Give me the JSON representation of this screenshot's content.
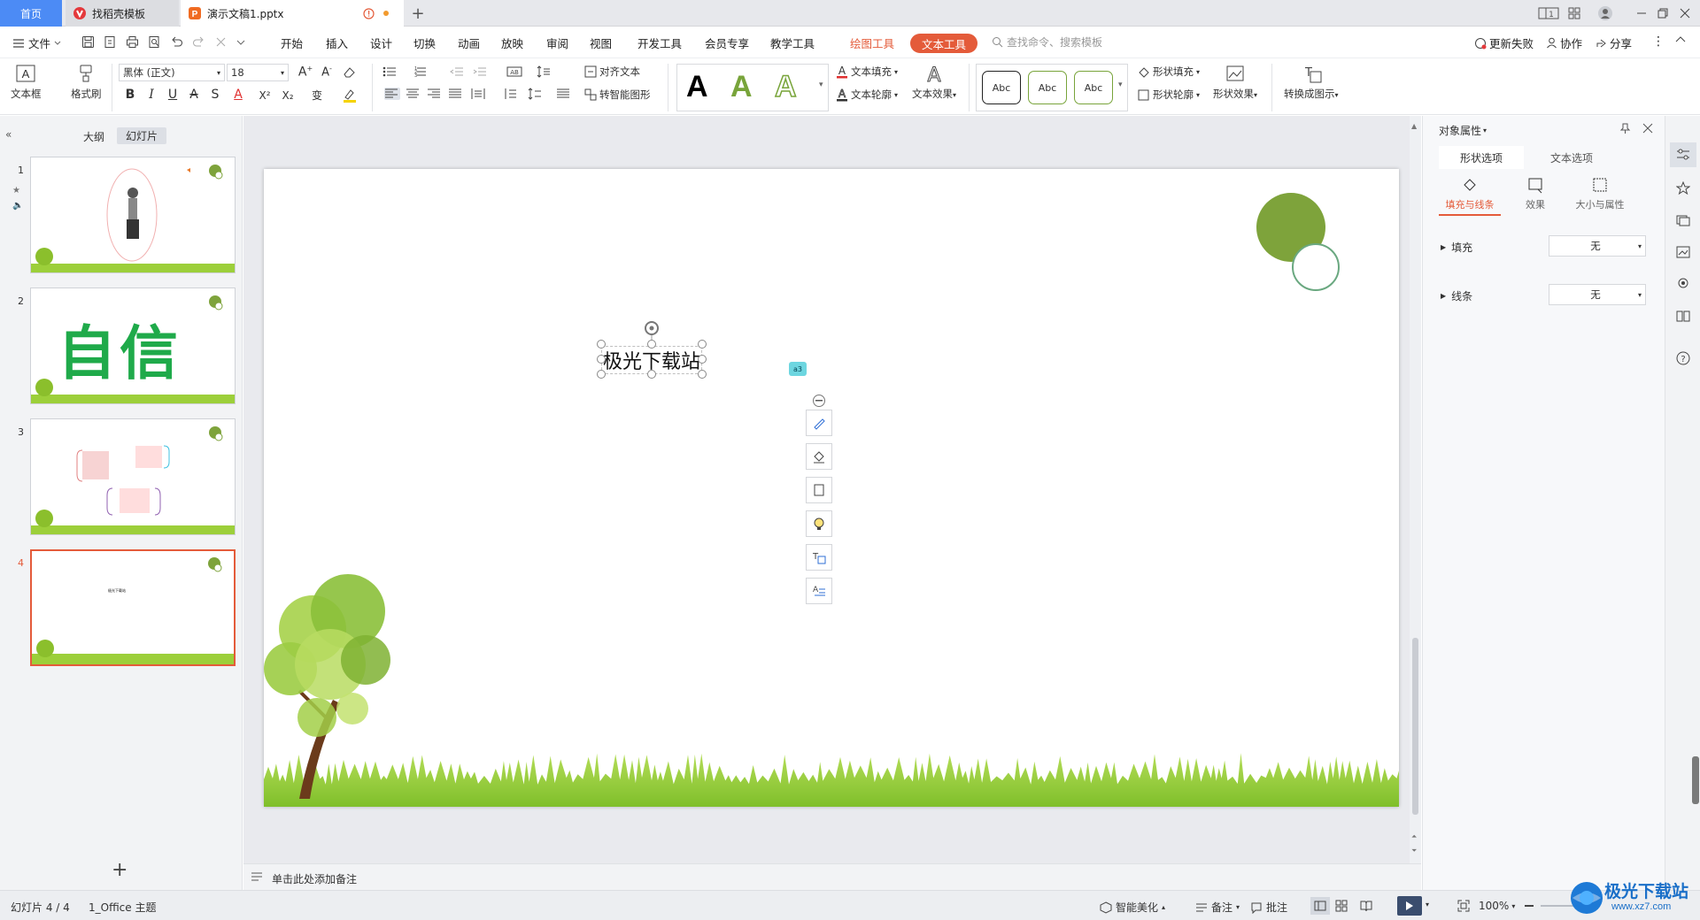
{
  "titlebar": {
    "tab_home": "首页",
    "tab_template": "找稻壳模板",
    "tab_doc": "演示文稿1.pptx",
    "new_tab": "+",
    "layout_badge": "1",
    "window_controls": [
      "minimize-icon",
      "restore-icon",
      "close-icon"
    ]
  },
  "menubar": {
    "file": "文件",
    "items": [
      "开始",
      "插入",
      "设计",
      "切换",
      "动画",
      "放映",
      "审阅",
      "视图",
      "开发工具",
      "会员专享",
      "教学工具"
    ],
    "drawing_tool": "绘图工具",
    "text_tool": "文本工具",
    "search_placeholder": "查找命令、搜索模板",
    "update_failed": "更新失败",
    "collaborate": "协作",
    "share": "分享"
  },
  "ribbon": {
    "textbox": "文本框",
    "format_painter": "格式刷",
    "font_name": "黑体 (正文)",
    "font_size": "18",
    "align_text": "对齐文本",
    "smart_shape": "转智能图形",
    "text_fill": "文本填充",
    "text_outline": "文本轮廓",
    "text_effect": "文本效果",
    "style_sample": "Abc",
    "shape_fill": "形状填充",
    "shape_outline": "形状轮廓",
    "shape_effect": "形状效果",
    "convert_diagram": "转换成图示",
    "bold": "B",
    "italic": "I",
    "underline": "U",
    "strike": "A",
    "shadow": "S",
    "super": "X²",
    "sub": "X₂",
    "art_letter": "A",
    "colors": {
      "accent": "#e45b3a",
      "font_color": "#e03030",
      "highlight": "#f5d300",
      "art_green": "#78a43a"
    }
  },
  "leftpanel": {
    "tab_outline": "大纲",
    "tab_slides": "幻灯片",
    "slide_numbers": [
      "1",
      "2",
      "3",
      "4"
    ],
    "slide2_text": "自信",
    "slide4_text": "极光下载站",
    "add_slide": "+"
  },
  "slide": {
    "textbox_text": "极光下载站",
    "badge": "a3"
  },
  "notes": {
    "placeholder": "单击此处添加备注"
  },
  "rightpane": {
    "title": "对象属性",
    "tab_shape": "形状选项",
    "tab_text": "文本选项",
    "sub_fill_line": "填充与线条",
    "sub_effect": "效果",
    "sub_size": "大小与属性",
    "fill_label": "填充",
    "fill_value": "无",
    "line_label": "线条",
    "line_value": "无"
  },
  "statusbar": {
    "slide_pos": "幻灯片 4 / 4",
    "theme": "1_Office 主题",
    "smart_beautify": "智能美化",
    "notes": "备注",
    "comments": "批注",
    "zoom": "100%",
    "watermark": "极光下载站",
    "watermark_url": "www.xz7.com"
  }
}
